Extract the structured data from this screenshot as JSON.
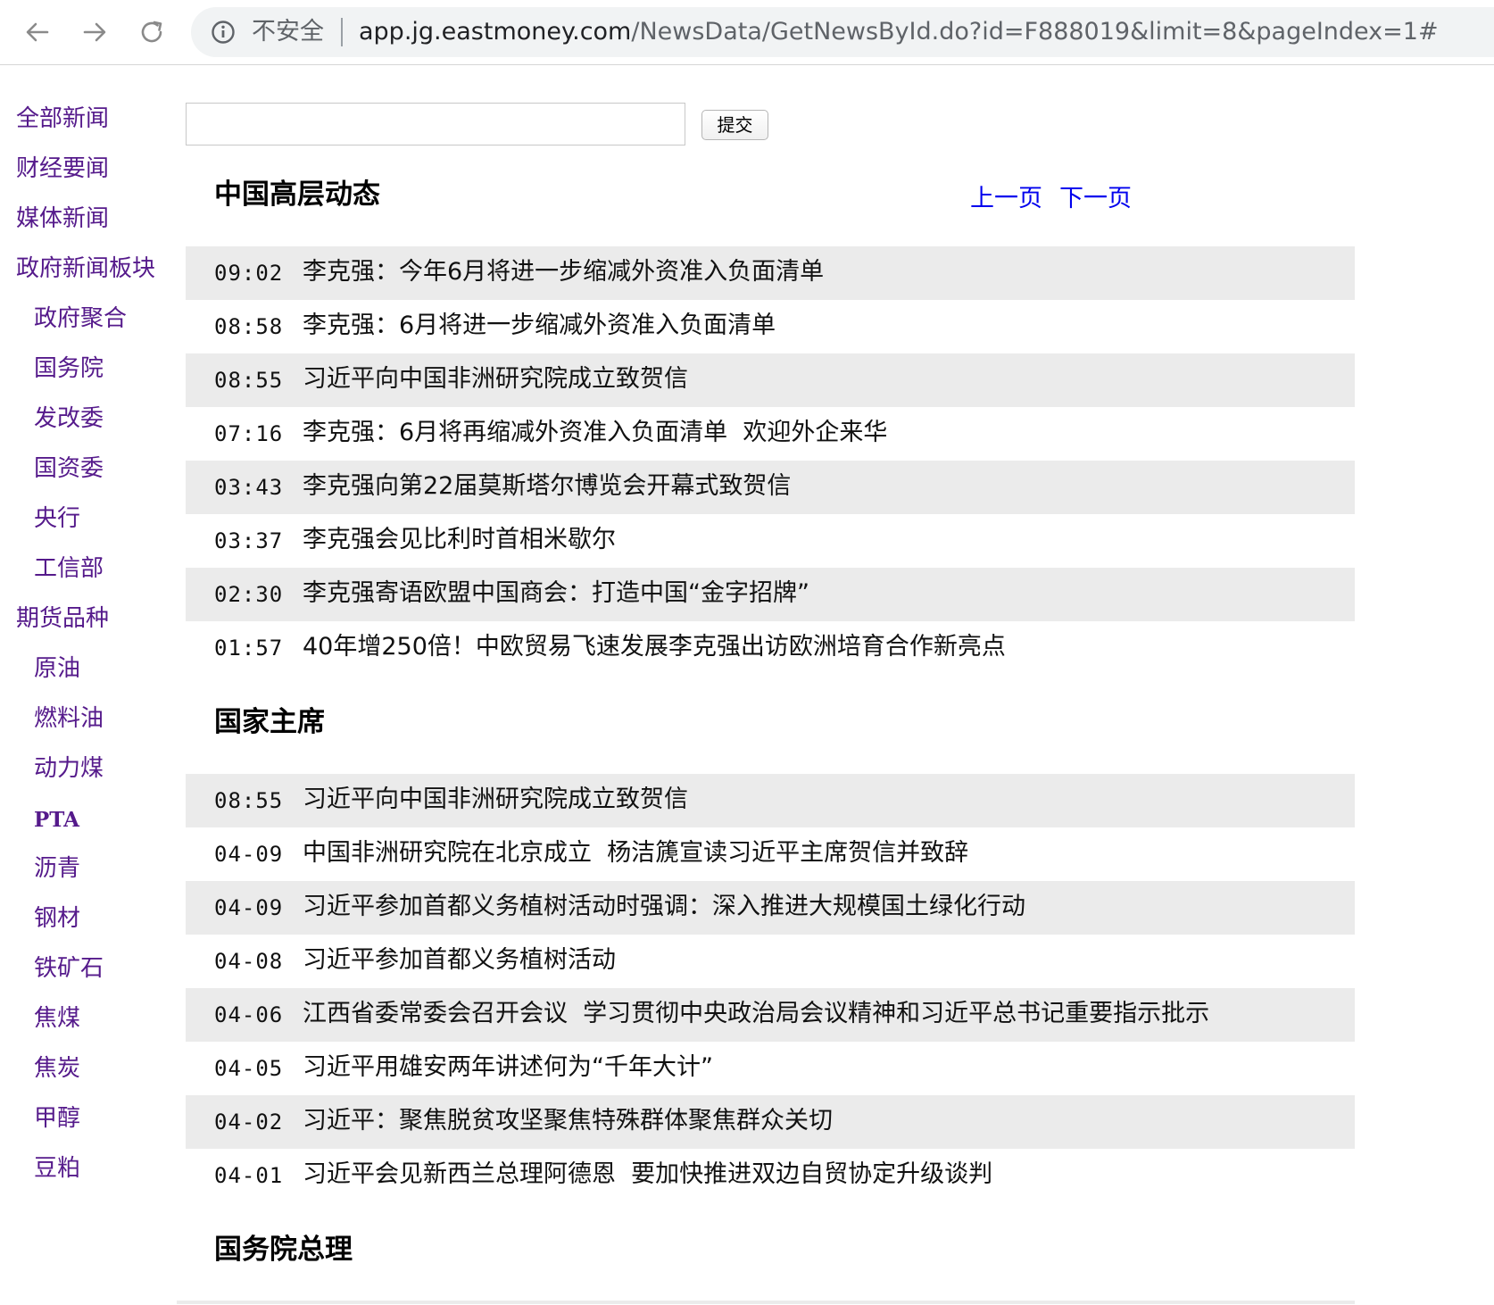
{
  "browser": {
    "security_label": "不安全",
    "url_host": "app.jg.eastmoney.com",
    "url_path": "/NewsData/GetNewsById.do?id=F888019&limit=8&pageIndex=1#"
  },
  "sidebar": {
    "items": [
      {
        "label": "全部新闻"
      },
      {
        "label": "财经要闻"
      },
      {
        "label": "媒体新闻"
      },
      {
        "label": "政府新闻板块"
      },
      {
        "label": "政府聚合"
      },
      {
        "label": "国务院"
      },
      {
        "label": "发改委"
      },
      {
        "label": "国资委"
      },
      {
        "label": "央行"
      },
      {
        "label": "工信部"
      },
      {
        "label": "期货品种"
      },
      {
        "label": "原油"
      },
      {
        "label": "燃料油"
      },
      {
        "label": "动力煤"
      },
      {
        "label": "PTA"
      },
      {
        "label": "沥青"
      },
      {
        "label": "钢材"
      },
      {
        "label": "铁矿石"
      },
      {
        "label": "焦煤"
      },
      {
        "label": "焦炭"
      },
      {
        "label": "甲醇"
      },
      {
        "label": "豆粕"
      }
    ]
  },
  "search": {
    "value": "",
    "submit_label": "提交"
  },
  "pager": {
    "prev_label": "上一页",
    "next_label": "下一页"
  },
  "sections": [
    {
      "title": "中国高层动态",
      "rows": [
        {
          "time": "09:02",
          "title": "李克强：今年6月将进一步缩减外资准入负面清单"
        },
        {
          "time": "08:58",
          "title": "李克强：6月将进一步缩减外资准入负面清单"
        },
        {
          "time": "08:55",
          "title": "习近平向中国非洲研究院成立致贺信"
        },
        {
          "time": "07:16",
          "title": "李克强：6月将再缩减外资准入负面清单  欢迎外企来华"
        },
        {
          "time": "03:43",
          "title": "李克强向第22届莫斯塔尔博览会开幕式致贺信"
        },
        {
          "time": "03:37",
          "title": "李克强会见比利时首相米歇尔"
        },
        {
          "time": "02:30",
          "title": "李克强寄语欧盟中国商会：打造中国“金字招牌”"
        },
        {
          "time": "01:57",
          "title": "40年增250倍！中欧贸易飞速发展李克强出访欧洲培育合作新亮点"
        }
      ]
    },
    {
      "title": "国家主席",
      "rows": [
        {
          "time": "08:55",
          "title": "习近平向中国非洲研究院成立致贺信"
        },
        {
          "time": "04-09",
          "title": "中国非洲研究院在北京成立  杨洁篪宣读习近平主席贺信并致辞"
        },
        {
          "time": "04-09",
          "title": "习近平参加首都义务植树活动时强调：深入推进大规模国土绿化行动"
        },
        {
          "time": "04-08",
          "title": "习近平参加首都义务植树活动"
        },
        {
          "time": "04-06",
          "title": "江西省委常委会召开会议  学习贯彻中央政治局会议精神和习近平总书记重要指示批示"
        },
        {
          "time": "04-05",
          "title": "习近平用雄安两年讲述何为“千年大计”"
        },
        {
          "time": "04-02",
          "title": "习近平：聚焦脱贫攻坚聚焦特殊群体聚焦群众关切"
        },
        {
          "time": "04-01",
          "title": "习近平会见新西兰总理阿德恩  要加快推进双边自贸协定升级谈判"
        }
      ]
    },
    {
      "title": "国务院总理",
      "rows": []
    }
  ]
}
